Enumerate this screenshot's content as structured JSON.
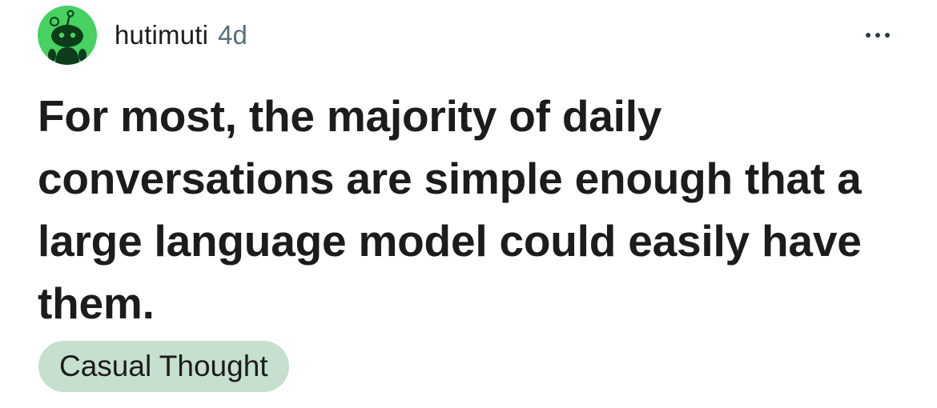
{
  "post": {
    "author": "hutimuti",
    "age": "4d",
    "avatar_icon": "snoo-avatar-icon",
    "avatar_color": "#46d160",
    "title": "For most, the majority of daily conversations are simple enough that a large language model could easily have them.",
    "flair": "Casual Thought",
    "flair_color": "#c6dfcf",
    "more_icon": "more-options-icon"
  }
}
